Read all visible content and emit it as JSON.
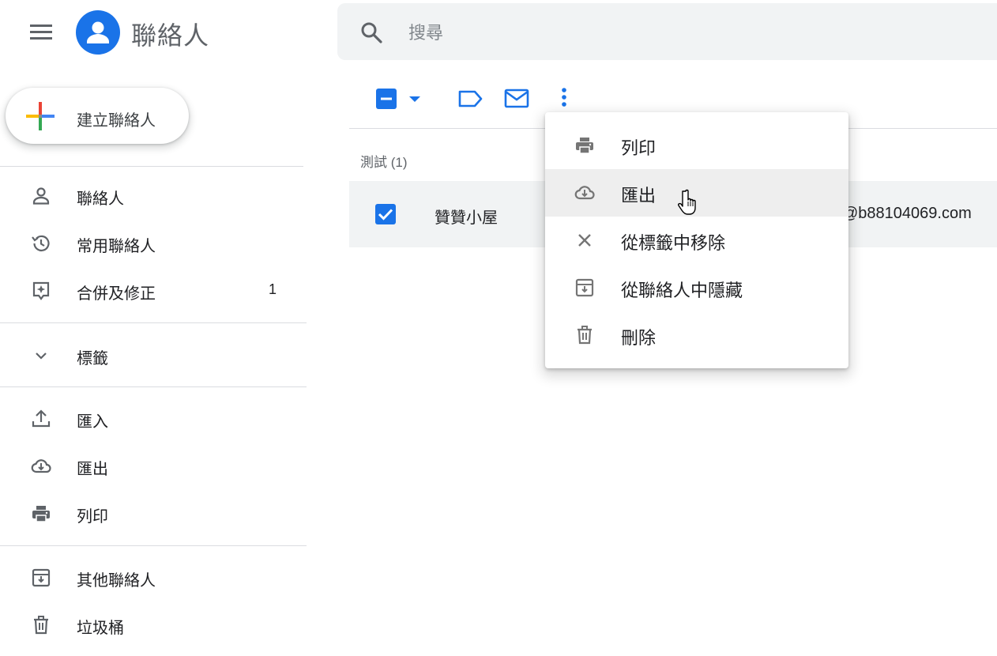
{
  "app": {
    "title": "聯絡人"
  },
  "search": {
    "placeholder": "搜尋"
  },
  "create_button": {
    "label": "建立聯絡人"
  },
  "sidebar": {
    "items": [
      {
        "label": "聯絡人",
        "icon": "person-icon"
      },
      {
        "label": "常用聯絡人",
        "icon": "history-icon"
      },
      {
        "label": "合併及修正",
        "icon": "merge-fix-icon",
        "count": "1"
      },
      {
        "label": "標籤",
        "icon": "chevron-down-icon"
      },
      {
        "label": "匯入",
        "icon": "upload-icon"
      },
      {
        "label": "匯出",
        "icon": "cloud-download-icon"
      },
      {
        "label": "列印",
        "icon": "printer-icon"
      },
      {
        "label": "其他聯絡人",
        "icon": "archive-icon"
      },
      {
        "label": "垃圾桶",
        "icon": "trash-icon"
      }
    ]
  },
  "toolbar": {
    "icons": [
      "select-partial-checkbox-icon",
      "caret-down-icon",
      "label-icon",
      "mail-icon",
      "more-vert-icon"
    ]
  },
  "list": {
    "group_header": "測試 (1)",
    "rows": [
      {
        "name": "贊贊小屋",
        "email": "@b88104069.com",
        "checked": true
      }
    ]
  },
  "menu": {
    "items": [
      {
        "label": "列印",
        "icon": "printer-icon"
      },
      {
        "label": "匯出",
        "icon": "cloud-download-icon",
        "hovered": true
      },
      {
        "label": "從標籤中移除",
        "icon": "close-icon"
      },
      {
        "label": "從聯絡人中隱藏",
        "icon": "archive-icon"
      },
      {
        "label": "刪除",
        "icon": "trash-icon"
      }
    ]
  },
  "colors": {
    "accent": "#1a73e8",
    "icon_gray": "#5f6368",
    "hover_bg": "#eeeeee",
    "row_bg": "#f1f3f4"
  }
}
